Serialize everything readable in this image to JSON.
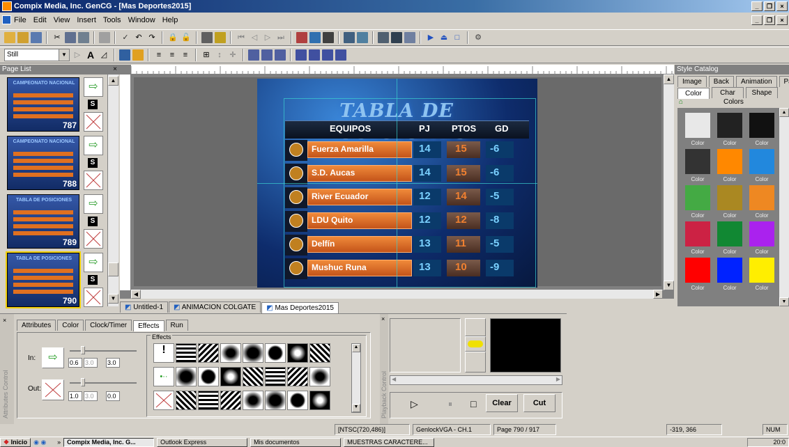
{
  "window": {
    "title": "Compix Media, Inc. GenCG - [Mas Deportes2015]"
  },
  "menu": [
    "File",
    "Edit",
    "View",
    "Insert",
    "Tools",
    "Window",
    "Help"
  ],
  "toolbar2": {
    "style_combo": "Still"
  },
  "page_list": {
    "title": "Page List",
    "pages": [
      {
        "title": "CAMPEONATO NACIONAL",
        "sub": "RESULTADOS",
        "number": "787"
      },
      {
        "title": "CAMPEONATO NACIONAL",
        "sub": "RESULTADOS",
        "number": "788"
      },
      {
        "title": "TABLA DE POSICIONES",
        "sub": "EQUIPOS   PJ  PTOS  GD",
        "number": "789"
      },
      {
        "title": "TABLA DE POSICIONES",
        "sub": "EQUIPOS   PJ  PTOS  GD",
        "number": "790"
      }
    ]
  },
  "graphic": {
    "title": "TABLA DE POSICIONES",
    "headers": [
      "EQUIPOS",
      "PJ",
      "PTOS",
      "GD"
    ],
    "rows": [
      {
        "team": "Fuerza Amarilla",
        "pj": "14",
        "ptos": "15",
        "gd": "-6"
      },
      {
        "team": "S.D. Aucas",
        "pj": "14",
        "ptos": "15",
        "gd": "-6"
      },
      {
        "team": "River Ecuador",
        "pj": "12",
        "ptos": "14",
        "gd": "-5"
      },
      {
        "team": "LDU Quito",
        "pj": "12",
        "ptos": "12",
        "gd": "-8"
      },
      {
        "team": "Delfín",
        "pj": "13",
        "ptos": "11",
        "gd": "-5"
      },
      {
        "team": "Mushuc Runa",
        "pj": "13",
        "ptos": "10",
        "gd": "-9"
      }
    ]
  },
  "doc_tabs": [
    "Untitled-1",
    "ANIMACION COLGATE",
    "Mas Deportes2015"
  ],
  "style_catalog": {
    "title": "Style Catalog",
    "tabs_row1": [
      "Image",
      "Back",
      "Animation",
      "Page"
    ],
    "tabs_row2": [
      "Color",
      "Char",
      "Shape"
    ],
    "group_label": "Colors",
    "swatches": [
      {
        "label": "Color",
        "color": "#e8e8e8"
      },
      {
        "label": "Color",
        "color": "#222222"
      },
      {
        "label": "Color",
        "color": "#111111"
      },
      {
        "label": "Color",
        "color": "#333333"
      },
      {
        "label": "Color",
        "color": "#ff8800"
      },
      {
        "label": "Color",
        "color": "#2288dd"
      },
      {
        "label": "Color",
        "color": "#44aa44"
      },
      {
        "label": "Color",
        "color": "#aa8822"
      },
      {
        "label": "Color",
        "color": "#ee8822"
      },
      {
        "label": "Color",
        "color": "#cc2244"
      },
      {
        "label": "Color",
        "color": "#118833"
      },
      {
        "label": "Color",
        "color": "#aa22ee"
      },
      {
        "label": "Color",
        "color": "#ff0000"
      },
      {
        "label": "Color",
        "color": "#0022ff"
      },
      {
        "label": "Color",
        "color": "#ffee00"
      }
    ]
  },
  "attributes": {
    "tabs": [
      "Attributes",
      "Color",
      "Clock/Timer",
      "Effects",
      "Run"
    ],
    "active_tab": "Effects",
    "side_label": "Attributes Control",
    "in_label": "In:",
    "out_label": "Out:",
    "in_values": [
      "0.6",
      "3.0",
      "3.0"
    ],
    "out_values": [
      "1.0",
      "3.0",
      "0.0"
    ],
    "effects_label": "Effects"
  },
  "playback": {
    "side_label": "Playback Control",
    "clear": "Clear",
    "cut": "Cut"
  },
  "status": {
    "format": "[NTSC(720,486)]",
    "genlock": "GenlockVGA - CH.1",
    "page": "Page 790 / 917",
    "coords": "-319, 366",
    "num": "NUM"
  },
  "taskbar": {
    "start": "Inicio",
    "tasks": [
      "Compix Media, Inc. G...",
      "Outlook Express",
      "Mis documentos",
      "MUESTRAS CARACTERE..."
    ],
    "clock": "20:0"
  }
}
